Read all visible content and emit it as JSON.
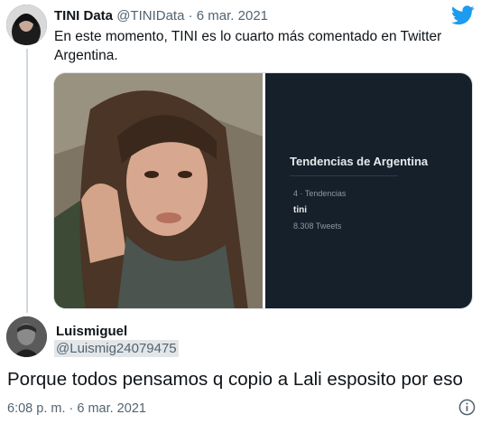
{
  "tweet": {
    "display_name": "TINI Data",
    "handle": "@TINIData",
    "separator": "·",
    "date": "6 mar. 2021",
    "text": "En este momento, TINI es lo cuarto más comentado en Twitter Argentina."
  },
  "trends_card": {
    "title": "Tendencias de Argentina",
    "meta": "4 · Tendencias",
    "trend": "tini",
    "count": "8.308 Tweets"
  },
  "reply": {
    "display_name": "Luismiguel",
    "handle": "@Luismig24079475",
    "text": "Porque todos pensamos q copio a Lali esposito por eso",
    "timestamp": "6:08 p. m. · 6 mar. 2021"
  },
  "icons": {
    "brand": "twitter-bird-icon",
    "info": "info-icon"
  },
  "colors": {
    "twitter_blue": "#1d9bf0",
    "dark_panel": "#15202b",
    "muted_text": "#536471"
  }
}
